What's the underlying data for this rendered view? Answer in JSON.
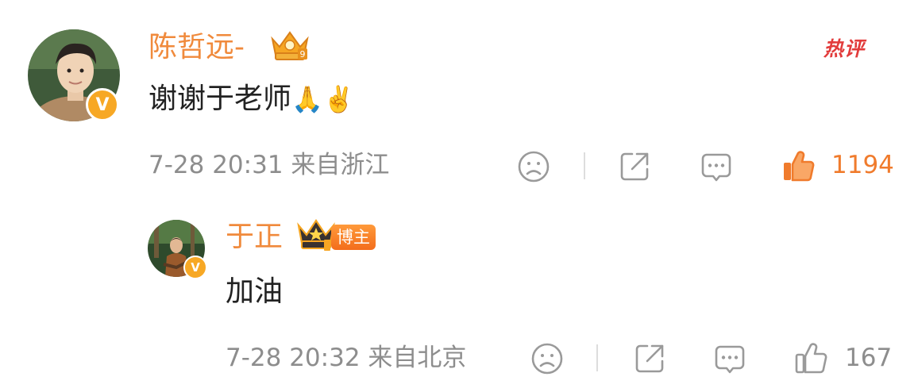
{
  "comment": {
    "author": "陈哲远-",
    "text": "谢谢于老师",
    "emoji": "🙏✌️",
    "time": "7-28 20:31",
    "location": "来自浙江",
    "hot_label": "热评",
    "likes": "1194"
  },
  "reply": {
    "author": "于正",
    "badge": "博主",
    "text": "加油",
    "time": "7-28 20:32",
    "location": "来自北京",
    "likes": "167"
  },
  "colors": {
    "name": "#f08a3c",
    "liked": "#f07b2c",
    "meta": "#8d8d8d",
    "hot": "#e23b3b"
  },
  "icons": {
    "dislike": "sad-face-icon",
    "share": "share-icon",
    "comment": "comment-bubble-icon",
    "like": "thumbs-up-icon"
  }
}
